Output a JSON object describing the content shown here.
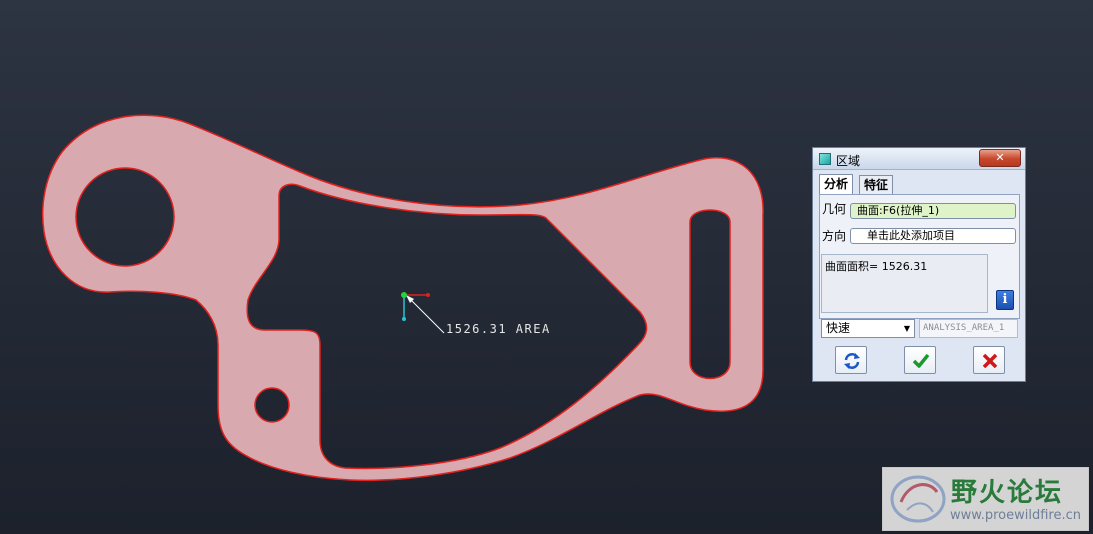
{
  "annotation": {
    "text": "1526.31 AREA"
  },
  "dialog": {
    "title": "区域",
    "close_label": "✕",
    "tabs": [
      {
        "label": "分析",
        "active": true
      },
      {
        "label": "特征",
        "active": false
      }
    ],
    "geometry": {
      "label": "几何",
      "value": "曲面:F6(拉伸_1)"
    },
    "direction": {
      "label": "方向",
      "value": "单击此处添加项目"
    },
    "result": {
      "text": "曲面面积= 1526.31"
    },
    "info_icon": "i",
    "mode": {
      "selected": "快速"
    },
    "name_field": {
      "value": "ANALYSIS_AREA_1"
    },
    "buttons": {
      "refresh_icon": "refresh-icon",
      "ok_icon": "check-icon",
      "cancel_icon": "close-icon"
    }
  },
  "watermark": {
    "title": "野火论坛",
    "url": "www.proewildfire.cn"
  },
  "colors": {
    "part_fill": "#d8aab0",
    "part_edge": "#e0221e",
    "background": "#252b37"
  }
}
